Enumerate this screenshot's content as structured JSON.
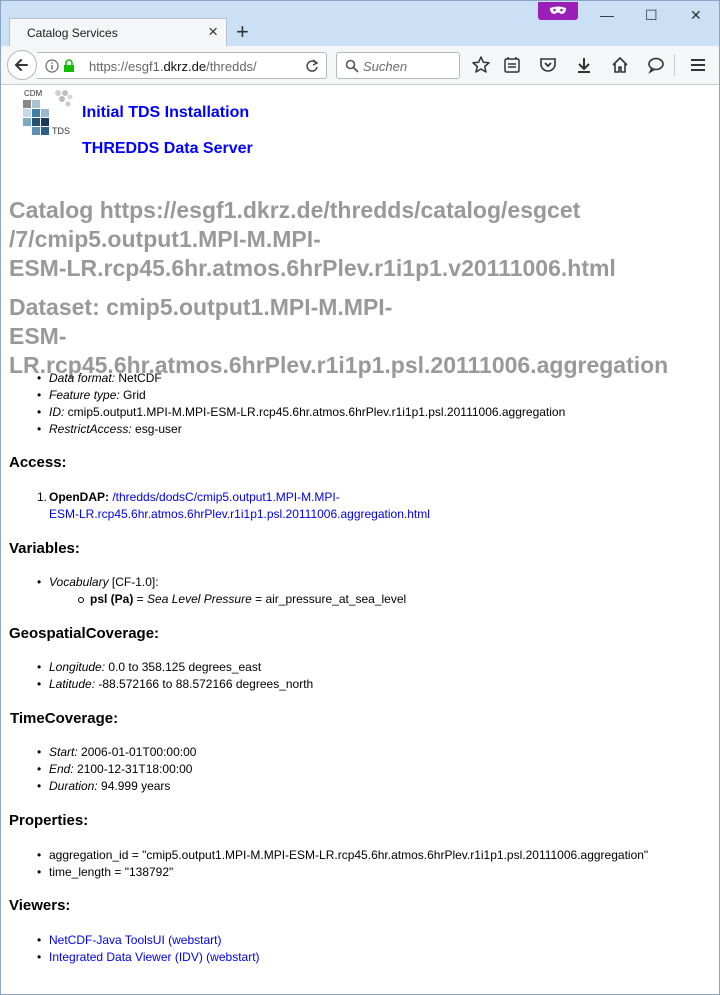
{
  "browser": {
    "tab_title": "Catalog Services",
    "url_prefix": "https://esgf1.",
    "url_host": "dkrz.de",
    "url_path": "/thredds/",
    "search_placeholder": "Suchen"
  },
  "header": {
    "logo_text_top": "CDM",
    "logo_text_bottom": "TDS",
    "link_install": "Initial TDS Installation",
    "link_server": "THREDDS Data Server"
  },
  "catalog_heading": {
    "line1": "Catalog https://esgf1.dkrz.de/thredds/catalog/esgcet",
    "line2": "/7/cmip5.output1.MPI-M.MPI-",
    "line3": "ESM-LR.rcp45.6hr.atmos.6hrPlev.r1i1p1.v20111006.html"
  },
  "dataset_heading": {
    "line1": "Dataset: cmip5.output1.MPI-M.MPI-",
    "line2": "ESM-LR.rcp45.6hr.atmos.6hrPlev.r1i1p1.psl.20111006.aggregation"
  },
  "info": [
    {
      "key": "Data format:",
      "value": " NetCDF"
    },
    {
      "key": "Feature type:",
      "value": " Grid"
    },
    {
      "key": "ID:",
      "value": " cmip5.output1.MPI-M.MPI-ESM-LR.rcp45.6hr.atmos.6hrPlev.r1i1p1.psl.20111006.aggregation"
    },
    {
      "key": "RestrictAccess:",
      "value": " esg-user"
    }
  ],
  "access": {
    "title": "Access:",
    "number": "1.",
    "service": "OpenDAP:",
    "link_line1": "/thredds/dodsC/cmip5.output1.MPI-M.MPI-",
    "link_line2": "ESM-LR.rcp45.6hr.atmos.6hrPlev.r1i1p1.psl.20111006.aggregation.html"
  },
  "variables": {
    "title": "Variables:",
    "vocab_key": "Vocabulary",
    "vocab_value": " [CF-1.0]:",
    "var_name": "psl (Pa)",
    "var_eq1": " = ",
    "var_desc": "Sea Level Pressure",
    "var_eq2": " = air_pressure_at_sea_level"
  },
  "geo": {
    "title": "GeospatialCoverage:",
    "items": [
      {
        "key": "Longitude:",
        "value": " 0.0 to 358.125 degrees_east"
      },
      {
        "key": "Latitude:",
        "value": " -88.572166 to 88.572166 degrees_north"
      }
    ]
  },
  "time": {
    "title": "TimeCoverage:",
    "items": [
      {
        "key": "Start:",
        "value": " 2006-01-01T00:00:00"
      },
      {
        "key": "End:",
        "value": " 2100-12-31T18:00:00"
      },
      {
        "key": "Duration:",
        "value": " 94.999 years"
      }
    ]
  },
  "properties": {
    "title": "Properties:",
    "items": [
      "aggregation_id = \"cmip5.output1.MPI-M.MPI-ESM-LR.rcp45.6hr.atmos.6hrPlev.r1i1p1.psl.20111006.aggregation\"",
      "time_length = \"138792\""
    ]
  },
  "viewers": {
    "title": "Viewers:",
    "items": [
      "NetCDF-Java ToolsUI (webstart)",
      "Integrated Data Viewer (IDV) (webstart)"
    ]
  },
  "colors": {
    "link": "#0000ee",
    "header_link": "#0000ff",
    "heading_gray": "#999999"
  }
}
